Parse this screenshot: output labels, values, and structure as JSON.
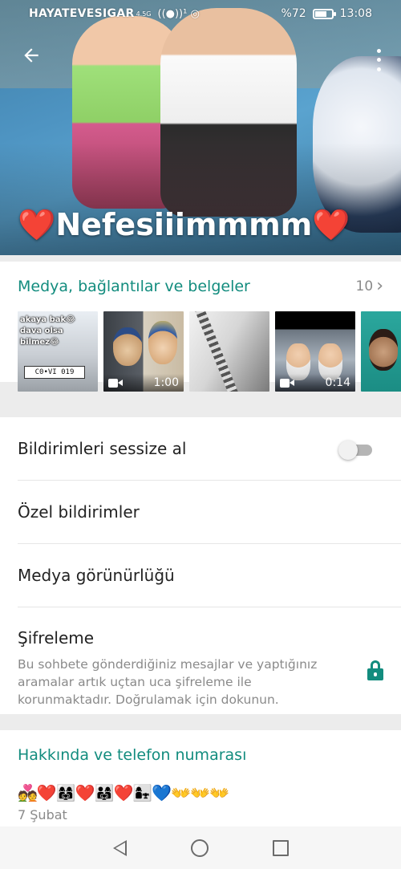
{
  "status_bar": {
    "carrier": "HAYATEVESIGAR",
    "network": "4.5G",
    "signal_glyph": "((●))¹ ◎",
    "battery_percent_text": "%72",
    "battery_level": 0.72,
    "time": "13:08"
  },
  "header": {
    "contact_name": "❤️Nefesiiimmmm❤️",
    "back_icon": "arrow-left-icon",
    "menu_icon": "more-vertical-icon"
  },
  "media": {
    "title": "Medya, bağlantılar ve belgeler",
    "count": "10",
    "chevron": "›",
    "thumbs": [
      {
        "overlay_text_1": "akaya bak😂",
        "overlay_text_2": "dava olsa",
        "overlay_text_3": "bilmez😂",
        "plate": "C0•VI 019"
      },
      {
        "duration": "1:00"
      },
      {},
      {
        "duration": "0:14"
      },
      {}
    ]
  },
  "settings": {
    "mute_label": "Bildirimleri sessize al",
    "mute_enabled": false,
    "custom_notifications_label": "Özel bildirimler",
    "media_visibility_label": "Medya görünürlüğü",
    "encryption_label": "Şifreleme",
    "encryption_description": "Bu sohbete gönderdiğiniz mesajlar ve yaptığınız aramalar artık uçtan uca şifreleme ile korunmaktadır. Doğrulamak için dokunun."
  },
  "about": {
    "title": "Hakkında ve telefon numarası",
    "status": "💑❤️👩‍👩‍👧❤️👨‍👩‍👧❤️👩‍👧💙👐👐👐",
    "date": "7 Şubat"
  },
  "colors": {
    "accent": "#128c7e",
    "secondary_text": "#8a8a8a"
  }
}
